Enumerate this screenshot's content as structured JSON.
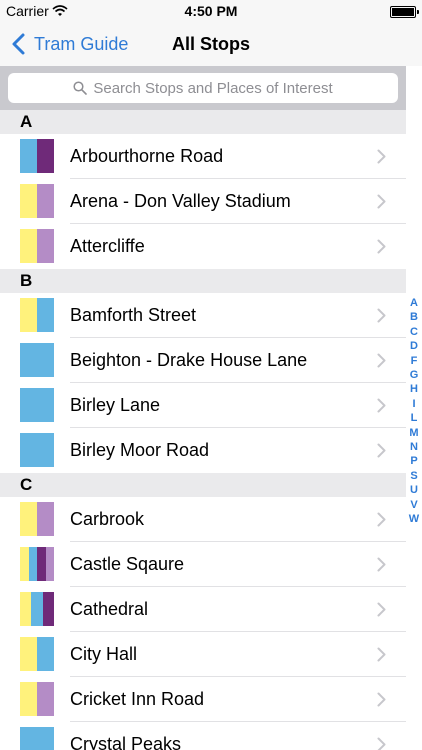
{
  "status_bar": {
    "carrier": "Carrier",
    "time": "4:50 PM"
  },
  "nav": {
    "back_label": "Tram Guide",
    "title": "All Stops"
  },
  "search": {
    "placeholder": "Search Stops and Places of Interest"
  },
  "colors": {
    "yellow": "#fff27c",
    "blue": "#63b5e2",
    "purple": "#b48cc6",
    "dark_purple": "#6f2a79",
    "accent": "#2f7bd6"
  },
  "sections": [
    {
      "letter": "A",
      "rows": [
        {
          "name": "Arbourthorne Road",
          "lines": [
            "blue",
            "dark_purple"
          ]
        },
        {
          "name": "Arena - Don Valley Stadium",
          "lines": [
            "yellow",
            "purple"
          ]
        },
        {
          "name": "Attercliffe",
          "lines": [
            "yellow",
            "purple"
          ]
        }
      ]
    },
    {
      "letter": "B",
      "rows": [
        {
          "name": "Bamforth Street",
          "lines": [
            "yellow",
            "blue"
          ]
        },
        {
          "name": "Beighton - Drake House Lane",
          "lines": [
            "blue"
          ]
        },
        {
          "name": "Birley Lane",
          "lines": [
            "blue"
          ]
        },
        {
          "name": "Birley Moor Road",
          "lines": [
            "blue"
          ]
        }
      ]
    },
    {
      "letter": "C",
      "rows": [
        {
          "name": "Carbrook",
          "lines": [
            "yellow",
            "purple"
          ]
        },
        {
          "name": "Castle Sqaure",
          "lines": [
            "yellow",
            "blue",
            "dark_purple",
            "purple"
          ]
        },
        {
          "name": "Cathedral",
          "lines": [
            "yellow",
            "blue",
            "dark_purple"
          ]
        },
        {
          "name": "City Hall",
          "lines": [
            "yellow",
            "blue"
          ]
        },
        {
          "name": "Cricket Inn Road",
          "lines": [
            "yellow",
            "purple"
          ]
        },
        {
          "name": "Crystal Peaks",
          "lines": [
            "blue"
          ]
        }
      ]
    }
  ],
  "index_letters": [
    "A",
    "B",
    "C",
    "D",
    "F",
    "G",
    "H",
    "I",
    "L",
    "M",
    "N",
    "P",
    "S",
    "U",
    "V",
    "W"
  ]
}
